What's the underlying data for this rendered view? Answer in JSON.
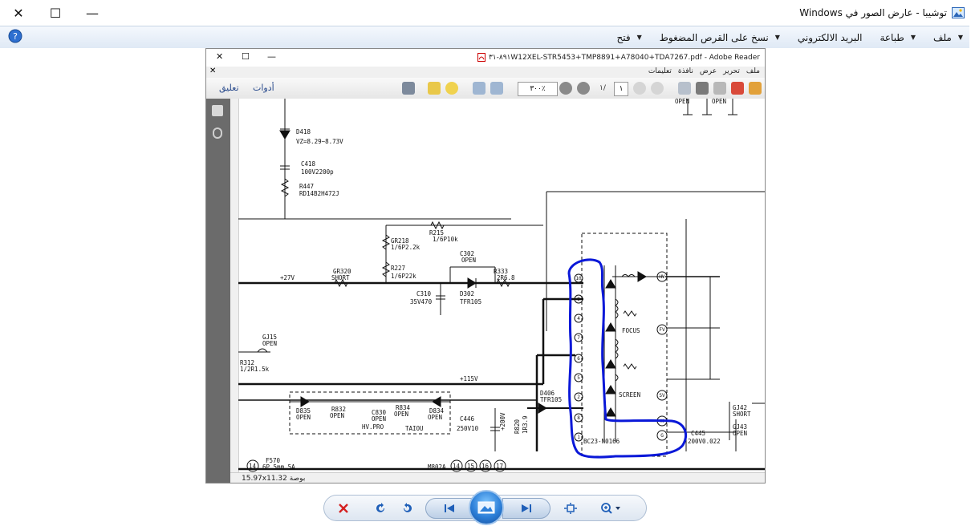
{
  "window": {
    "title": "توشيبا - عارض الصور في Windows",
    "controls": {
      "close": "✕",
      "maximize": "☐",
      "minimize": "—"
    }
  },
  "menu": {
    "items": [
      {
        "label": "ملف",
        "has_caret": true
      },
      {
        "label": "طباعة",
        "has_caret": true
      },
      {
        "label": "البريد الالكتروني",
        "has_caret": false
      },
      {
        "label": "نسخ على القرص المضغوط",
        "has_caret": true
      },
      {
        "label": "فتح",
        "has_caret": true
      }
    ]
  },
  "embedded": {
    "title": "٨٩١-٣١W12XEL-STR5453+TMP8891+A78040+TDA7267.pdf - Adobe Reader",
    "menu": [
      "ملف",
      "تحرير",
      "عرض",
      "نافذة",
      "تعليمات"
    ],
    "toolbar": {
      "tools_label": "أدوات",
      "comment_label": "تعليق",
      "zoom": "٣٠٠٪",
      "page": "١",
      "page_of": "١/"
    },
    "status": "15.97x11.32 بوصة"
  },
  "schematic": {
    "labels": {
      "d418": "D418",
      "vz": "VZ=8.29~8.73V",
      "c418": "C418",
      "c418v": "100V2200p",
      "r447": "R447",
      "r447v": "RD14B2H472J",
      "r215": "R215",
      "r215v": "1/6P10k",
      "gr218": "GR218",
      "gr218v": "1/6P2.2k",
      "r227": "R227",
      "r227v": "1/6P22k",
      "c302": "C302",
      "c302v": "OPEN",
      "r333": "R333",
      "r333v": "2R6.8",
      "v27": "+27V",
      "gr320": "GR320",
      "gr320v": "SHORT",
      "c310": "C310",
      "c310v": "35V470",
      "d302": "D302",
      "d302v": "TFR105",
      "gj15": "GJ15",
      "gj15v": "OPEN",
      "r312": "R312",
      "r312v": "1/2R1.5k",
      "v115": "+115V",
      "d406": "D406",
      "d406v": "TFR105",
      "d835": "D835",
      "d835v": "OPEN",
      "r832": "R832",
      "r832v": "OPEN",
      "c830": "C830",
      "c830v": "OPEN",
      "r834": "R834",
      "r834v": "OPEN",
      "d834": "D834",
      "d834v": "OPEN",
      "hvpro": "HV.PRO",
      "taiou": "TAIOU",
      "c446": "C446",
      "c446v": "250V10",
      "v200": "+200V",
      "r820": "R820",
      "r820v": "1R3.9",
      "focus": "FOCUS",
      "screen": "SCREEN",
      "fbt": "BC23-N0166",
      "gj42": "GJ42",
      "gj42v": "SHORT",
      "gj43": "GJ43",
      "gj43v": "OPEN",
      "c445": "C445",
      "c445v": "200V0.022",
      "f570": "F570",
      "f570v": "6P 5mm 5A",
      "m802a": "M802A",
      "openA": "OPEN",
      "openB": "OPEN",
      "pin14": "14",
      "pin15": "15",
      "pin16": "16",
      "pin17": "17"
    },
    "fbt_pins": [
      "10",
      "9",
      "4",
      "7",
      "6",
      "5",
      "2",
      "8",
      "1"
    ],
    "fbt_right_pins": [
      "HV",
      "FV",
      "SV",
      "H",
      "G"
    ]
  },
  "colors": {
    "annotation": "#0a18d8",
    "wire": "#111111",
    "accent": "#2c7fd8"
  }
}
